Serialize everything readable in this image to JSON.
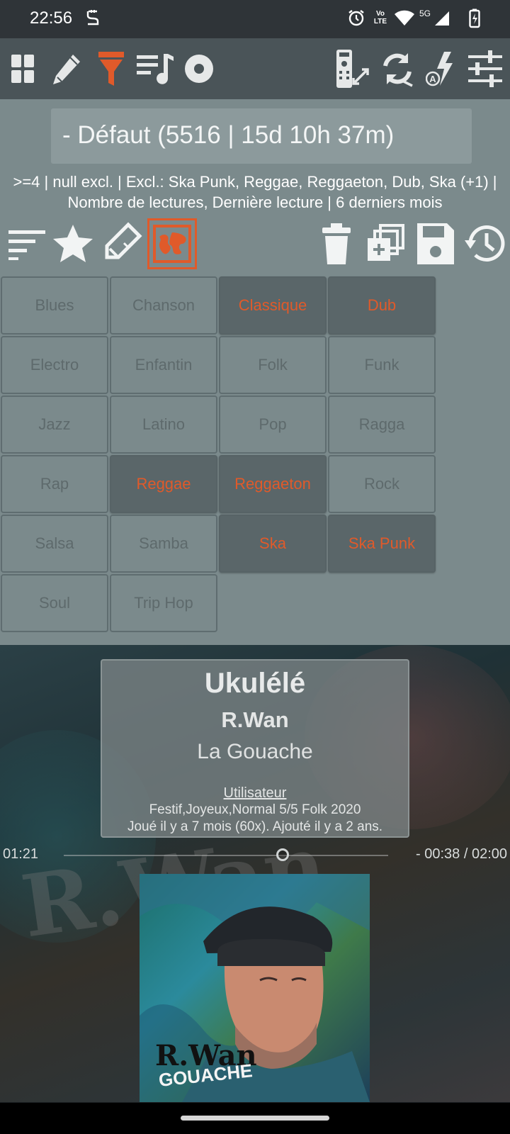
{
  "status_bar": {
    "time": "22:56",
    "network": "5G",
    "volte": "Vo LTE",
    "icons": [
      "alarm-icon",
      "volte-icon",
      "wifi-icon",
      "signal-icon",
      "battery-charging-icon"
    ]
  },
  "toolbar": {
    "left_icons": [
      "grid-icon",
      "pencil-icon",
      "filter-icon",
      "playlist-icon",
      "record-icon"
    ],
    "right_icons": [
      "remote-icon",
      "sync-icon",
      "auto-flash-icon",
      "sliders-icon"
    ],
    "active_icon": "filter-icon",
    "accent_color": "#e05a2a"
  },
  "preset": {
    "label": "- Défaut (5516 | 15d 10h 37m)"
  },
  "filter_summary": ">=4 | null excl. | Excl.: Ska Punk, Reggae, Reggaeton, Dub, Ska (+1) | Nombre de lectures, Dernière lecture | 6 derniers mois",
  "filter_tools": {
    "left_icons": [
      "sort-icon",
      "star-icon",
      "tag-icon",
      "map-icon"
    ],
    "right_icons": [
      "trash-icon",
      "duplicate-icon",
      "save-icon",
      "history-icon"
    ],
    "active_icon": "map-icon"
  },
  "genres": [
    {
      "label": "Blues",
      "selected": false
    },
    {
      "label": "Chanson",
      "selected": false
    },
    {
      "label": "Classique",
      "selected": true
    },
    {
      "label": "Dub",
      "selected": true
    },
    {
      "label": "Electro",
      "selected": false
    },
    {
      "label": "Enfantin",
      "selected": false
    },
    {
      "label": "Folk",
      "selected": false
    },
    {
      "label": "Funk",
      "selected": false
    },
    {
      "label": "Jazz",
      "selected": false
    },
    {
      "label": "Latino",
      "selected": false
    },
    {
      "label": "Pop",
      "selected": false
    },
    {
      "label": "Ragga",
      "selected": false
    },
    {
      "label": "Rap",
      "selected": false
    },
    {
      "label": "Reggae",
      "selected": true
    },
    {
      "label": "Reggaeton",
      "selected": true
    },
    {
      "label": "Rock",
      "selected": false
    },
    {
      "label": "Salsa",
      "selected": false
    },
    {
      "label": "Samba",
      "selected": false
    },
    {
      "label": "Ska",
      "selected": true
    },
    {
      "label": "Ska Punk",
      "selected": true
    },
    {
      "label": "Soul",
      "selected": false
    },
    {
      "label": "Trip Hop",
      "selected": false
    }
  ],
  "now_playing": {
    "title": "Ukulélé",
    "artist": "R.Wan",
    "album": "La Gouache",
    "source": "Utilisateur",
    "tags": "Festif,Joyeux,Normal 5/5 Folk 2020",
    "played": "Joué il y a 7 mois (60x). Ajouté il y a 2 ans.",
    "elapsed": "01:21",
    "remaining_total": "- 00:38 / 02:00",
    "progress": 0.675,
    "cover_text_1": "R.Wan",
    "cover_text_2": "LA GOUACHE"
  }
}
